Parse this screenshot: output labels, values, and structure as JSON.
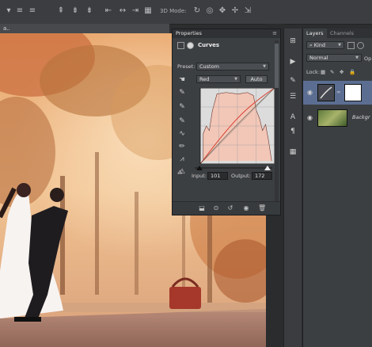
{
  "options_bar": {
    "mode_3d_label": "3D Mode:"
  },
  "document": {
    "tab_label": "a.."
  },
  "properties": {
    "panel_title": "Properties",
    "adjustment_name": "Curves",
    "preset_label": "Preset:",
    "preset_value": "Custom",
    "channel_value": "Red",
    "auto_label": "Auto",
    "input_label": "Input:",
    "input_value": "101",
    "output_label": "Output:",
    "output_value": "172",
    "menu_icon": "≡"
  },
  "layers": {
    "tab_layers": "Layers",
    "tab_channels": "Channels",
    "kind_label": "Kind",
    "blend_mode": "Normal",
    "opacity_label": "Op",
    "lock_label": "Lock:",
    "items": [
      {
        "name": ""
      },
      {
        "name": "Backgr"
      }
    ]
  },
  "colors": {
    "accent": "#6b8fd6",
    "histogram": "#f2c7b8",
    "curve_red": "#d93a2a"
  }
}
